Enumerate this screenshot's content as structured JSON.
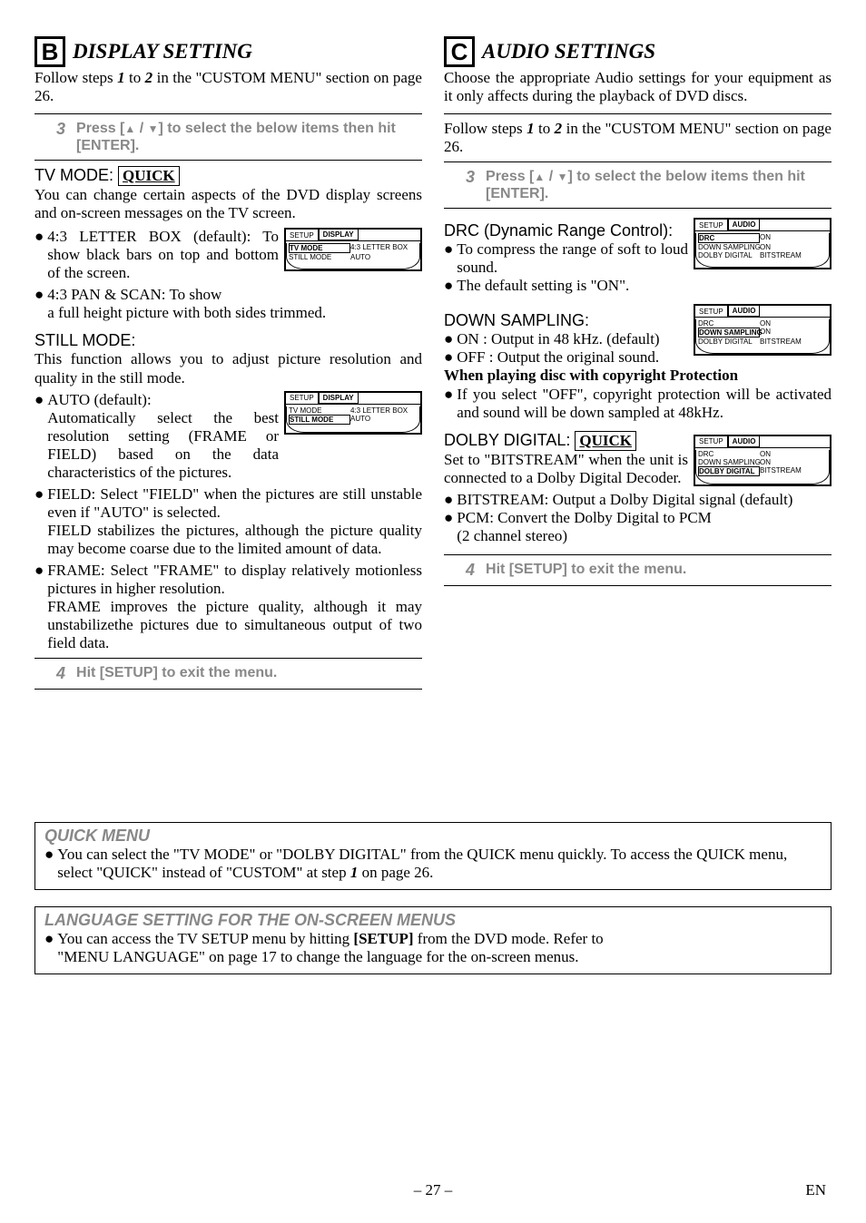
{
  "left": {
    "letter": "B",
    "title": "DISPLAY SETTING",
    "intro_a": "Follow steps ",
    "intro_b": " to ",
    "intro_c": " in the \"CUSTOM MENU\" section on page 26.",
    "one": "1",
    "two": "2",
    "step3num": "3",
    "step3a": "Press [",
    "step3b": " / ",
    "step3c": "] to select the below items then hit [ENTER].",
    "tvmode_label": "TV MODE: ",
    "quick": "QUICK",
    "tvmode_body": "You can change certain aspects of the DVD display screens and on-screen messages on the TV screen.",
    "tv_b1": "4:3 LETTER BOX (default): To show black bars on top and bottom of the screen.",
    "tv_b2": "4:3 PAN & SCAN: To show",
    "tv_b2b": "a full height picture with both sides trimmed.",
    "still_label": "STILL MODE:",
    "still_body": "This function allows you to adjust picture resolution and quality in the still mode.",
    "still_b1": "AUTO (default):",
    "still_b1b": "Automatically select the best resolution setting (FRAME or FIELD) based on the data characteristics of the pictures.",
    "still_b2": "FIELD: Select \"FIELD\" when the pictures are still unstable even if \"AUTO\" is selected.",
    "still_b2b": "FIELD stabilizes the pictures, although the picture quality may become coarse due to the limited amount of data.",
    "still_b3": "FRAME: Select \"FRAME\" to display relatively motionless pictures in higher resolution.",
    "still_b3b": "FRAME improves the picture quality, although it may unstabilizethe pictures due to simultaneous output of two field data.",
    "step4num": "4",
    "step4": "Hit [SETUP] to exit the menu.",
    "osd1": {
      "tab1": "SETUP",
      "tab2": "DISPLAY",
      "r1l": "TV MODE",
      "r1r": "4:3 LETTER BOX",
      "r2l": "STILL MODE",
      "r2r": "AUTO"
    },
    "osd2": {
      "tab1": "SETUP",
      "tab2": "DISPLAY",
      "r1l": "TV MODE",
      "r1r": "4:3 LETTER BOX",
      "r2l": "STILL MODE",
      "r2r": "AUTO"
    }
  },
  "right": {
    "letter": "C",
    "title": "AUDIO SETTINGS",
    "intro": "Choose the appropriate Audio settings for your equipment as it only affects during the playback of DVD discs.",
    "follow_a": "Follow steps ",
    "follow_b": " to ",
    "follow_c": " in the \"CUSTOM MENU\" section on page 26.",
    "one": "1",
    "two": "2",
    "step3num": "3",
    "step3a": "Press [",
    "step3b": " / ",
    "step3c": "] to select the below items then hit [ENTER].",
    "drc_label": "DRC (Dynamic Range Control):",
    "drc_b1": "To compress the range of soft to loud sound.",
    "drc_b2": "The default setting is \"ON\".",
    "down_label": "DOWN SAMPLING:",
    "down_b1": "ON : Output in 48 kHz. (default)",
    "down_b2": "OFF : Output the original sound.",
    "down_head": "When playing disc with copyright Protection",
    "down_b3": "If you select \"OFF\", copyright protection will be activated and sound will be down sampled at 48kHz.",
    "dolby_label": "DOLBY DIGITAL: ",
    "quick": "QUICK",
    "dolby_body": "Set to \"BITSTREAM\" when the unit is connected to a Dolby Digital Decoder.",
    "dolby_b1": "BITSTREAM: Output a Dolby Digital signal (default)",
    "dolby_b2": "PCM: Convert the Dolby Digital to PCM",
    "dolby_b2b": "(2 channel stereo)",
    "step4num": "4",
    "step4": "Hit [SETUP] to exit the menu.",
    "osd1": {
      "tab1": "SETUP",
      "tab2": "AUDIO",
      "r1l": "DRC",
      "r1r": "ON",
      "r2l": "DOWN SAMPLING",
      "r2r": "ON",
      "r3l": "DOLBY DIGITAL",
      "r3r": "BITSTREAM"
    },
    "osd2": {
      "tab1": "SETUP",
      "tab2": "AUDIO",
      "r1l": "DRC",
      "r1r": "ON",
      "r2l": "DOWN SAMPLING",
      "r2r": "ON",
      "r3l": "DOLBY DIGITAL",
      "r3r": "BITSTREAM"
    },
    "osd3": {
      "tab1": "SETUP",
      "tab2": "AUDIO",
      "r1l": "DRC",
      "r1r": "ON",
      "r2l": "DOWN SAMPLING",
      "r2r": "ON",
      "r3l": "DOLBY DIGITAL",
      "r3r": "BITSTREAM"
    }
  },
  "quickmenu": {
    "title": "QUICK MENU",
    "body_a": "You can select the \"TV MODE\" or \"DOLBY DIGITAL\" from the QUICK menu quickly. To access the QUICK menu, select \"QUICK\" instead of \"CUSTOM\" at step ",
    "one": "1",
    "body_b": " on page 26."
  },
  "langmenu": {
    "title": "LANGUAGE SETTING FOR THE ON-SCREEN MENUS",
    "body_a": "You can access the TV SETUP menu by hitting ",
    "setup": "[SETUP]",
    "body_b": " from the DVD mode. Refer to",
    "body_c": "\"MENU LANGUAGE\" on page 17 to change the language for the on-screen menus."
  },
  "footer": {
    "page": "– 27 –",
    "lang": "EN"
  }
}
